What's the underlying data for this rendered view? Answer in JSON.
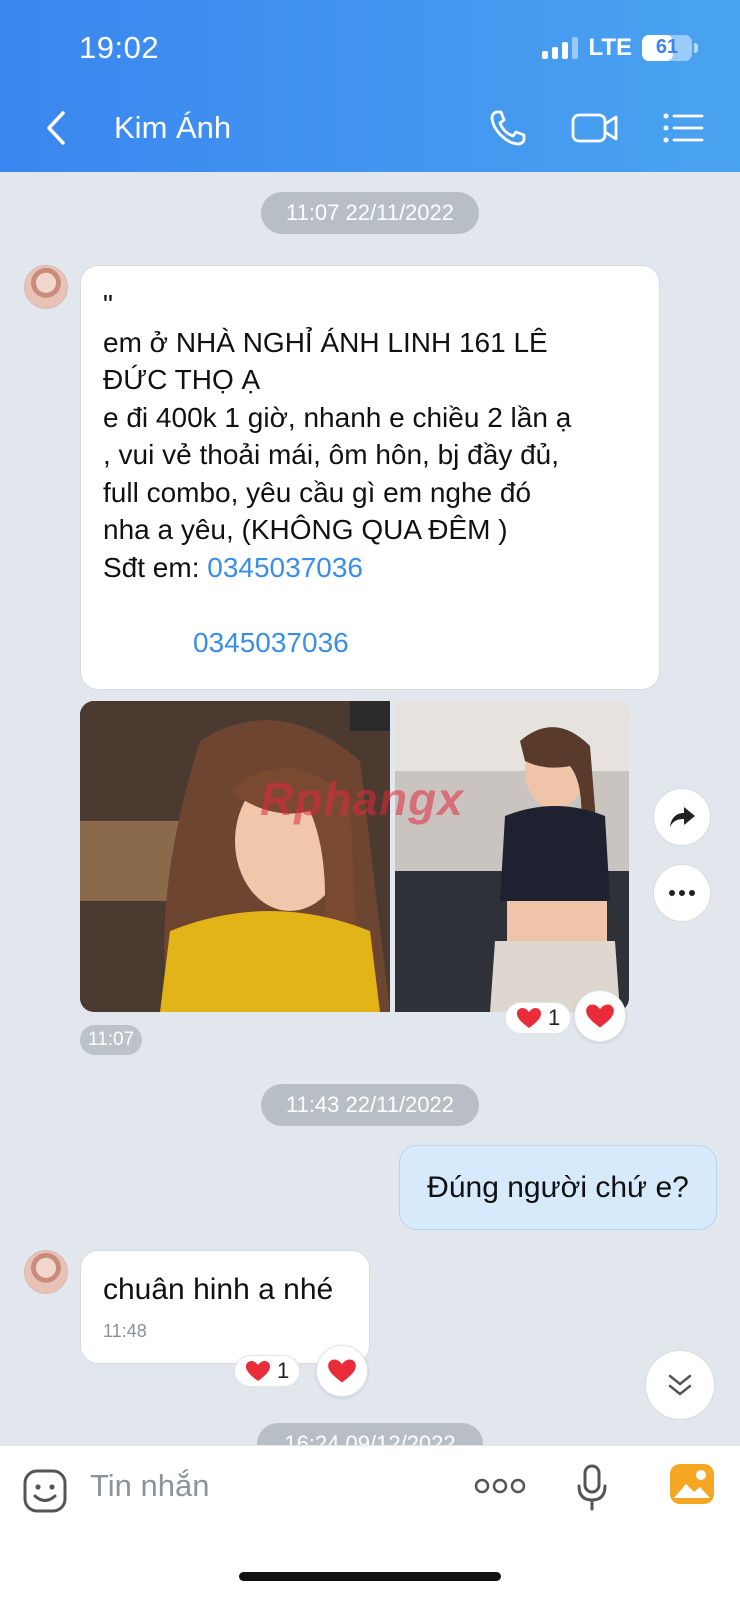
{
  "status_bar": {
    "time": "19:02",
    "network": "LTE",
    "battery": "61",
    "battery_level": 0.61
  },
  "header": {
    "contact_name": "Kim Ánh"
  },
  "chat": {
    "timestamp_1": "11:07 22/11/2022",
    "message_1": {
      "line_0": "\"",
      "line_1": "em ở  NHÀ NGHỈ ÁNH LINH 161 LÊ",
      "line_2": "ĐỨC THỌ Ạ",
      "line_3": "e đi 400k 1 giờ, nhanh e chiều 2 lần ạ",
      "line_4": ", vui vẻ thoải mái, ôm hôn, bj đầy đủ,",
      "line_5": "full combo, yêu cầu gì em nghe đó",
      "line_6": "nha a yêu, (KHÔNG QUA ĐÊM )",
      "phone_label": "Sđt em: ",
      "phone_link": "0345037036",
      "phone_link_2": "0345037036"
    },
    "image_watermark": "Rphangx",
    "image_time": "11:07",
    "image_reaction_count": "1",
    "timestamp_2": "11:43 22/11/2022",
    "outgoing_message": "Đúng người chứ e?",
    "incoming_2": {
      "text": "chuân hinh a nhé",
      "time": "11:48"
    },
    "incoming_2_reaction_count": "1",
    "timestamp_3": "16:24 09/12/2022"
  },
  "input": {
    "placeholder": "Tin nhắn"
  }
}
